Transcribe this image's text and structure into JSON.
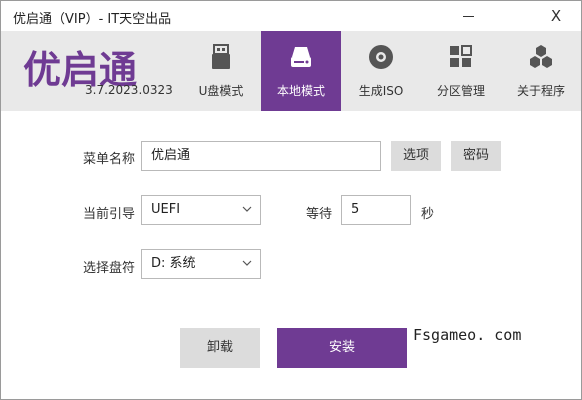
{
  "window": {
    "title": "优启通（VIP）- IT天空出品",
    "close_glyph": "X"
  },
  "header": {
    "logo": "优启通",
    "version": "3.7.2023.0323",
    "tabs": [
      {
        "label": "U盘模式",
        "icon": "usb-drive-icon",
        "active": false
      },
      {
        "label": "本地模式",
        "icon": "hard-disk-icon",
        "active": true
      },
      {
        "label": "生成ISO",
        "icon": "disc-icon",
        "active": false
      },
      {
        "label": "分区管理",
        "icon": "partition-grid-icon",
        "active": false
      },
      {
        "label": "关于程序",
        "icon": "hexagons-icon",
        "active": false
      }
    ]
  },
  "form": {
    "menu_name_label": "菜单名称",
    "menu_name_value": "优启通",
    "options_button": "选项",
    "password_button": "密码",
    "boot_label": "当前引导",
    "boot_value": "UEFI",
    "wait_label": "等待",
    "wait_value": "5",
    "wait_unit": "秒",
    "drive_label": "选择盘符",
    "drive_value": "D: 系统"
  },
  "actions": {
    "unmount": "卸载",
    "install": "安装"
  },
  "watermark": "Fsgameo. com",
  "colors": {
    "accent": "#6f3b93",
    "header_bg": "#e9e9e9",
    "button_gray": "#dcdcdc"
  }
}
